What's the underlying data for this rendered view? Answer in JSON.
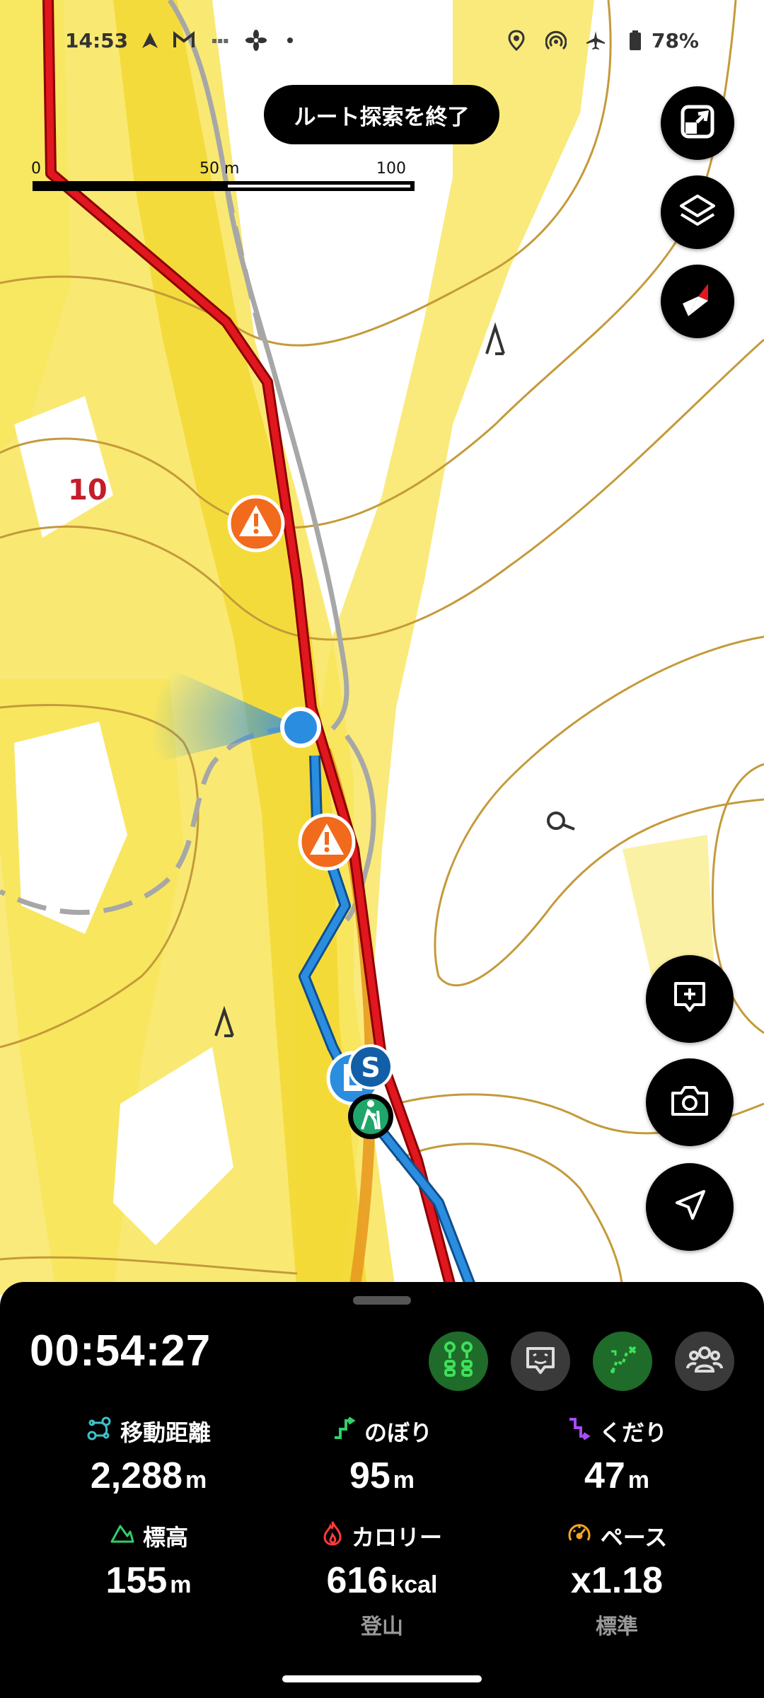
{
  "status_bar": {
    "time": "14:53",
    "battery": "78%",
    "left_icons": [
      "navigation-icon",
      "gmail-icon",
      "app-icon",
      "fan-icon",
      "dot-icon"
    ],
    "right_icons": [
      "location-icon",
      "hotspot-icon",
      "airplane-icon",
      "battery-icon"
    ]
  },
  "map": {
    "end_route_label": "ルート探索を終了",
    "scale": {
      "tick_0": "0",
      "tick_1": "50 m",
      "tick_2": "100 m"
    },
    "contour_label": "10",
    "colors": {
      "route_red": "#e0171e",
      "track_blue": "#2b8de0",
      "path_gray": "#a7a7a7",
      "heat_yellow": "#f7e23a",
      "contour": "#c49a3a"
    }
  },
  "fab_buttons": [
    "fullscreen-exit-icon",
    "layers-icon",
    "compass-icon",
    "add-note-icon",
    "camera-icon",
    "locate-icon"
  ],
  "panel": {
    "elapsed_time": "00:54:27",
    "tool_buttons": [
      "route-marker-icon",
      "face-icon",
      "route-branch-icon",
      "group-icon"
    ],
    "stats": {
      "distance": {
        "label": "移動距離",
        "value": "2,288",
        "unit": "m"
      },
      "ascent": {
        "label": "のぼり",
        "value": "95",
        "unit": "m"
      },
      "descent": {
        "label": "くだり",
        "value": "47",
        "unit": "m"
      },
      "elevation": {
        "label": "標高",
        "value": "155",
        "unit": "m"
      },
      "calories": {
        "label": "カロリー",
        "value": "616",
        "unit": "kcal",
        "sub": "登山"
      },
      "pace": {
        "label": "ペース",
        "value": "x1.18",
        "unit": "",
        "sub": "標準"
      }
    }
  }
}
